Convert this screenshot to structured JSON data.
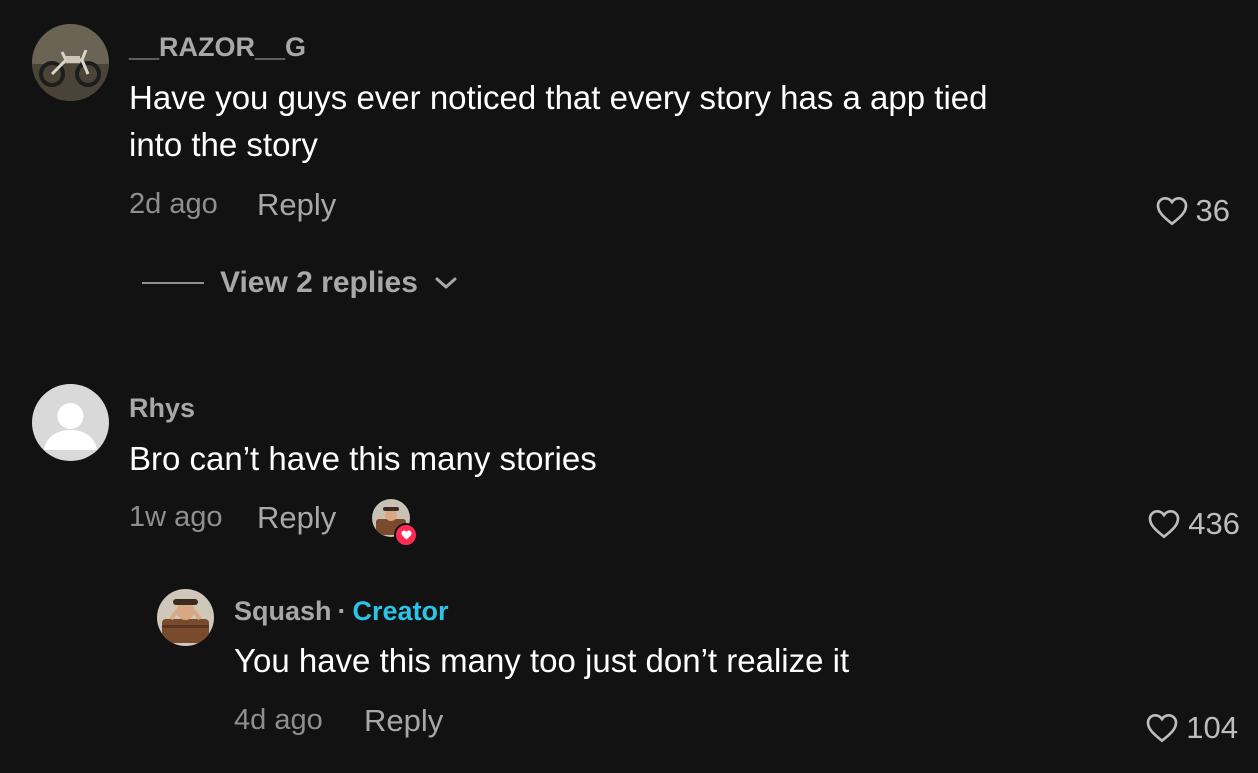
{
  "comments": [
    {
      "username": "__RAZOR__G",
      "text_lines": [
        "Have you guys ever noticed that every story has a app tied",
        "into the story"
      ],
      "time": "2d ago",
      "reply_label": "Reply",
      "likes": "36",
      "view_replies_label": "View 2 replies",
      "avatar_icon": "motorbike-photo-avatar"
    },
    {
      "username": "Rhys",
      "text": "Bro can’t have this many stories",
      "time": "1w ago",
      "reply_label": "Reply",
      "likes": "436",
      "avatar_icon": "default-user-avatar",
      "creator_liked_icon": "creator-liked-heart-icon"
    }
  ],
  "reply": {
    "username": "Squash",
    "separator": "·",
    "creator_label": "Creator",
    "text": "You have this many too just don’t realize it",
    "time": "4d ago",
    "reply_label": "Reply",
    "likes": "104",
    "avatar_icon": "creator-photo-avatar"
  },
  "colors": {
    "background": "#121212",
    "creator_accent": "#29c4e6",
    "like_badge": "#fe2c55"
  }
}
